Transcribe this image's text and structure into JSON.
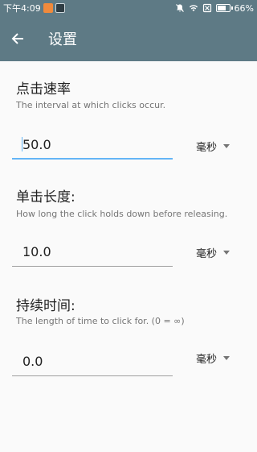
{
  "status_bar": {
    "time": "下午4:09",
    "battery": "66%",
    "battery_level": 0.66
  },
  "app_bar": {
    "title": "设置",
    "back_icon": "arrow-back-icon"
  },
  "settings": [
    {
      "title": "点击速率",
      "description": "The interval at which clicks occur.",
      "value": "50.0",
      "unit": "毫秒",
      "focused": true
    },
    {
      "title": "单击长度:",
      "description": "How long the click holds down before releasing.",
      "value": "10.0",
      "unit": "毫秒",
      "focused": false
    },
    {
      "title": "持续时间:",
      "description": "The length of time to click for. (0 = ∞)",
      "value": "0.0",
      "unit": "毫秒",
      "focused": false
    }
  ],
  "colors": {
    "app_bar": "#5e7a85",
    "focus": "#64b5f6",
    "background": "#fafafa"
  }
}
